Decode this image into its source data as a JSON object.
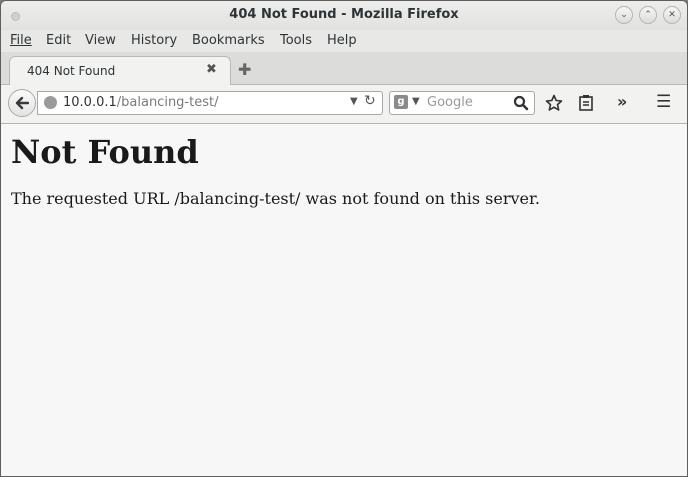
{
  "window": {
    "title": "404 Not Found - Mozilla Firefox",
    "min_glyph": "⌄",
    "max_glyph": "⌃",
    "close_glyph": "✕"
  },
  "menu": [
    {
      "label": "File"
    },
    {
      "label": "Edit"
    },
    {
      "label": "View"
    },
    {
      "label": "History"
    },
    {
      "label": "Bookmarks"
    },
    {
      "label": "Tools"
    },
    {
      "label": "Help"
    }
  ],
  "tabs": [
    {
      "label": "404 Not Found",
      "close_glyph": "✖"
    }
  ],
  "new_tab_glyph": "✚",
  "navbar": {
    "url_host": "10.0.0.1",
    "url_path": "/balancing-test/",
    "url_dropdown_glyph": "▼",
    "reload_glyph": "↻",
    "search_engine_letter": "g",
    "search_dropdown_glyph": "▼",
    "search_placeholder": "Google",
    "overflow_glyph": "»",
    "menu_glyph": "☰"
  },
  "page": {
    "heading": "Not Found",
    "message": "The requested URL /balancing-test/ was not found on this server."
  },
  "icons": {
    "back": "back-arrow-icon",
    "globe": "globe-icon",
    "search": "magnifier-icon",
    "bookmark": "star-icon",
    "library": "clipboard-icon"
  }
}
